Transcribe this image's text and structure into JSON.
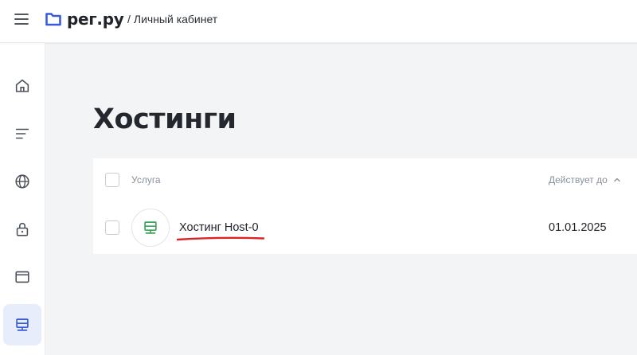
{
  "header": {
    "logo_text": "рег.ру",
    "breadcrumb_separator": "/",
    "breadcrumb": "Личный кабинет",
    "brand_color": "#3a5bd8"
  },
  "sidebar": {
    "items": [
      {
        "icon": "home-icon",
        "active": false
      },
      {
        "icon": "list-icon",
        "active": false
      },
      {
        "icon": "globe-icon",
        "active": false
      },
      {
        "icon": "lock-icon",
        "active": false
      },
      {
        "icon": "browser-window-icon",
        "active": false
      },
      {
        "icon": "server-icon",
        "active": true
      }
    ],
    "active_color": "#3a5bd8",
    "active_bg": "#e8edfb"
  },
  "main": {
    "title": "Хостинги",
    "table": {
      "columns": {
        "service": "Услуга",
        "valid_until": "Действует до"
      },
      "sort_direction": "ascending",
      "rows": [
        {
          "service": "Хостинг Host-0",
          "valid_until": "01.01.2025",
          "icon": "server-icon",
          "icon_color": "#3aa55a"
        }
      ]
    },
    "annotation_color": "#d9252a"
  }
}
